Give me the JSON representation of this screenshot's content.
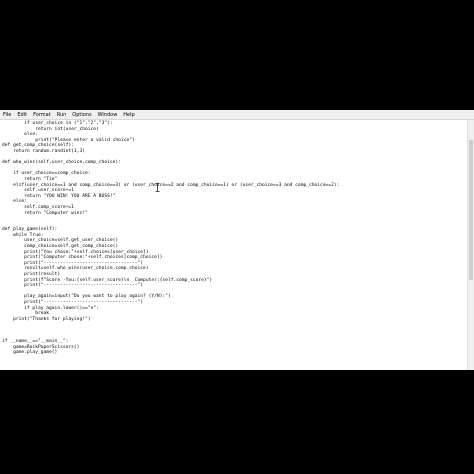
{
  "menu": [
    "File",
    "Edit",
    "Format",
    "Run",
    "Options",
    "Window",
    "Help"
  ],
  "code_lines": [
    "        if user_choice in (\"1\",\"2\",\"3\"):",
    "            return int(user_choice)",
    "        else:",
    "            print(\"Please enter a valid choice\")",
    "def get_comp_choice(self):",
    "    return random.randint(1,3)",
    "",
    "def who_wins(self,user_choice,comp_choice):",
    "",
    "    if user_choice==comp_choice:",
    "        return \"Tie\"",
    "    elif(user_choice==1 and comp_choice==3) or (user_choice==2 and comp_choice==1) or (user_choice==3 and comp_choice==2):",
    "        self.user_score+=1",
    "        return \"YOU WIN! YOU ARE A BOSS!\"",
    "    else:",
    "        self.comp_score+=1",
    "        return \"Computer wins!\"",
    "",
    "",
    "def play_game(self):",
    "    while True:",
    "        user_choice=self.get_user_choice()",
    "        comp_choice=self.get_comp_choice()",
    "        print(\"You chose:\"+self.choices[user_choice])",
    "        print(\"Computer chose:\"+self.choices[comp_choice])",
    "        print(\"----------------------------------\")",
    "        result=self.who_wins(user_choice,comp_choice)",
    "        print(result)",
    "        print(f\"Score -You:{self.user_score}\\n  Computer:{self.comp_score}\")",
    "        print(\"----------------------------------\")",
    "",
    "        play_again=input(\"Do you want to play again? (Y/N):\")",
    "        print(\"----------------------------------\")",
    "        if play_again.lower()==\"n\":",
    "            break",
    "    print(\"Thanks for playing!\")",
    "",
    "",
    "",
    "if __name__==\"__main__\":",
    "    game=RockPaperScissors()",
    "    game.play_game()"
  ],
  "icons": {
    "cursor": "i-beam-cursor-icon"
  }
}
